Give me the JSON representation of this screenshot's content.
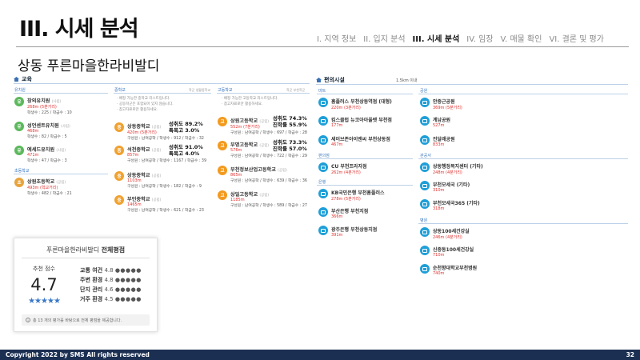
{
  "header": {
    "title": "III. 시세 분석",
    "nav": [
      "I. 지역 정보",
      "II. 입지 분석",
      "III. 시세 분석",
      "IV. 임장",
      "V. 매물 확인",
      "VI. 결론 및 평가"
    ],
    "active_index": 2
  },
  "subtitle": "상동 푸른마을한라비발디",
  "education": {
    "title": "교육",
    "kindergarten_header": "유치원",
    "kindergartens": [
      {
        "badge": "유",
        "name": "창의유치원",
        "type": "(사립)",
        "distance": "268m (5분거리)",
        "info": "학생수 : 225 / 학급수 : 10"
      },
      {
        "badge": "유",
        "name": "성언센트유치원",
        "type": "(사립)",
        "distance": "468m",
        "info": "학생수 : 82 / 학급수 : 5"
      },
      {
        "badge": "유",
        "name": "예세드유치원",
        "type": "(사립)",
        "distance": "471m",
        "info": "학생수 : 47 / 학급수 : 3"
      }
    ],
    "elementary_header": "초등학교",
    "elementary": [
      {
        "badge": "초",
        "name": "상원초등학교",
        "type": "(공립)",
        "distance": "493m (학교거리)",
        "info": "학생수 : 482 / 학급수 : 21"
      }
    ],
    "middle_header": "중학교",
    "middle_header_right": "학군 생활중학교",
    "middle_notes": [
      "· 배정 가능한 중학교 리스트입니다.",
      "· 공동학군은 포함되어 있지 않습니다.",
      "· 참고자료로만 활용하세요."
    ],
    "middle": [
      {
        "badge": "중",
        "name": "상동중학교",
        "type": "(공립)",
        "distance": "420m (5분거리)",
        "info": "구성원 : 남여공학 / 학생수 : 912 / 학급수 : 32",
        "rate1": "성취도 89.2%",
        "rate2": "특목고 3.0%"
      },
      {
        "badge": "중",
        "name": "석천중학교",
        "type": "(공립)",
        "distance": "857m",
        "info": "구성원 : 남여공학 / 학생수 : 1167 / 학급수 : 39",
        "rate1": "성취도 91.0%",
        "rate2": "특목고 4.0%"
      },
      {
        "badge": "중",
        "name": "상동중학교",
        "type": "(공립)",
        "distance": "1103m",
        "info": "구성원 : 남여공학 / 학생수 : 182 / 학급수 : 9",
        "rate1": "",
        "rate2": ""
      },
      {
        "badge": "중",
        "name": "부인중학교",
        "type": "(공립)",
        "distance": "1465m",
        "info": "구성원 : 남여공학 / 학생수 : 621 / 학급수 : 23",
        "rate1": "",
        "rate2": ""
      }
    ],
    "high_header": "고등학교",
    "high_header_right": "학군 부천학군",
    "high_notes": [
      "· 배정 가능한 고등학교 리스트입니다.",
      "· 참고자료로만 활용하세요."
    ],
    "high": [
      {
        "badge": "고",
        "name": "상원고등학교",
        "type": "(공립)",
        "distance": "552m (7분거리)",
        "info": "구성원 : 남여공학 / 학생수 : 697 / 학급수 : 28",
        "rate1": "성취도 74.3%",
        "rate2": "진학률 55.9%"
      },
      {
        "badge": "고",
        "name": "부명고등학교",
        "type": "(공립)",
        "distance": "576m",
        "info": "구성원 : 남여공학 / 학생수 : 722 / 학급수 : 29",
        "rate1": "성취도 73.3%",
        "rate2": "진학률 57.0%"
      },
      {
        "badge": "고",
        "name": "부천정보산업고등학교",
        "type": "(공립)",
        "distance": "865m",
        "info": "구성원 : 남여공학 / 학생수 : 639 / 학급수 : 36",
        "rate1": "",
        "rate2": ""
      },
      {
        "badge": "고",
        "name": "상일고등학교",
        "type": "(공립)",
        "distance": "1185m",
        "info": "구성원 : 남여공학 / 학생수 : 589 / 학급수 : 27",
        "rate1": "",
        "rate2": ""
      }
    ]
  },
  "convenience": {
    "title": "편의시설",
    "radius": "1.5km 이내",
    "left": [
      {
        "category": "마트",
        "items": [
          {
            "name": "홈플러스 부천상동역점 (대형)",
            "distance": "220m (3분거리)"
          },
          {
            "name": "킴스클럽 뉴코아아울렛 부천점",
            "distance": "177m"
          },
          {
            "name": "세이브존아이앤씨 부천상동점",
            "distance": "467m"
          }
        ]
      },
      {
        "category": "편의점",
        "items": [
          {
            "name": "CU 부천프라자점",
            "distance": "262m (4분거리)"
          }
        ]
      },
      {
        "category": "은행",
        "items": [
          {
            "name": "KB국민은행 부천홈플러스",
            "distance": "278m (5분거리)"
          },
          {
            "name": "부산은행 부천지점",
            "distance": "366m"
          },
          {
            "name": "광주은행 부천상동지점",
            "distance": "391m"
          }
        ]
      }
    ],
    "right": [
      {
        "category": "공원",
        "items": [
          {
            "name": "안중근공원",
            "distance": "369m (5분거리)"
          },
          {
            "name": "계남공원",
            "distance": "527m"
          },
          {
            "name": "진달래공원",
            "distance": "833m"
          }
        ]
      },
      {
        "category": "관공서",
        "items": [
          {
            "name": "상동행정복지센터 (기타)",
            "distance": "248m (4분거리)"
          },
          {
            "name": "부천모세국 (기타)",
            "distance": "310m"
          },
          {
            "name": "부천모세국365 (기타)",
            "distance": "318m"
          }
        ]
      },
      {
        "category": "병원",
        "items": [
          {
            "name": "상동100세건강실",
            "distance": "246m (4분거리)"
          },
          {
            "name": "신중동100세건강실",
            "distance": "710m"
          },
          {
            "name": "순천향대학교부천병원",
            "distance": "740m"
          }
        ]
      }
    ]
  },
  "rating": {
    "title_plain": "푸른마을한라비발디",
    "title_bold": "전체평점",
    "score_label": "추천 점수",
    "score": "4.7",
    "stars": 5,
    "items": [
      {
        "label": "교통 여건",
        "score": "4.8"
      },
      {
        "label": "주변 환경",
        "score": "4.8"
      },
      {
        "label": "단지 관리",
        "score": "4.6"
      },
      {
        "label": "거주 환경",
        "score": "4.5"
      }
    ],
    "footnote": "총 13 개의 평가를 바탕으로 전체 평점을 제공합니다."
  },
  "footer": {
    "copyright": "Copyright 2022 by SMS All rights reserved",
    "page": "32"
  },
  "colors": {
    "accent": "#2f6fc0",
    "distance": "#e0312f",
    "footer": "#1b2f52",
    "star": "#3a78c9"
  }
}
